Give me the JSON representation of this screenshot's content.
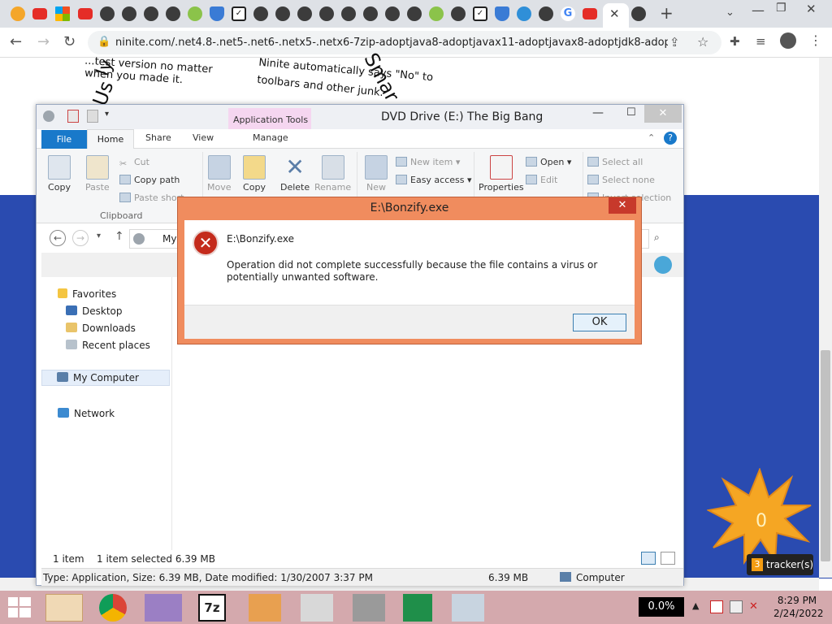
{
  "browser": {
    "url": "ninite.com/.net4.8-.net5-.net6-.netx5-.netx6-7zip-adoptjava8-adoptjavax11-adoptjavax8-adoptjdk8-adoptj...",
    "new_tab": "+"
  },
  "webpage": {
    "text1": "...test version no matter",
    "text2": "when you made it.",
    "text3": "Ninite automatically says \"No\" to",
    "text4": "toolbars and other junk.",
    "deco1": "Us",
    "deco2": "Smar",
    "deco3": "ly",
    "starburst_label": "0",
    "tracker_count": "3",
    "tracker_label": "tracker(s)"
  },
  "explorer": {
    "title": "DVD Drive (E:) The Big Bang",
    "context_tab": "Application Tools",
    "tabs": {
      "file": "File",
      "home": "Home",
      "share": "Share",
      "view": "View",
      "manage": "Manage"
    },
    "ribbon": {
      "copy": "Copy",
      "paste": "Paste",
      "cut": "Cut",
      "copy_path": "Copy path",
      "paste_shortcut": "Paste short",
      "clipboard_group": "Clipboard",
      "move": "Move",
      "copy_to": "Copy",
      "delete": "Delete",
      "rename": "Rename",
      "new": "New",
      "new_item": "New item",
      "easy_access": "Easy access",
      "properties": "Properties",
      "open": "Open",
      "edit": "Edit",
      "select_all": "Select all",
      "select_none": "Select none",
      "invert_selection": "Invert selection"
    },
    "path": "My",
    "nav": {
      "favorites": "Favorites",
      "desktop": "Desktop",
      "downloads": "Downloads",
      "recent": "Recent places",
      "my_computer": "My Computer",
      "network": "Network"
    },
    "status": {
      "items": "1 item",
      "selected": "1 item selected  6.39 MB"
    },
    "details": {
      "info": "Type: Application, Size: 6.39 MB, Date modified: 1/30/2007 3:37 PM",
      "size": "6.39 MB",
      "location": "Computer"
    }
  },
  "dialog": {
    "title": "E:\\Bonzify.exe",
    "heading": "E:\\Bonzify.exe",
    "message": "Operation did not complete successfully because the file contains a virus or potentially unwanted software.",
    "ok": "OK",
    "close": "✕"
  },
  "taskbar": {
    "cpu": "0.0%",
    "time": "8:29 PM",
    "date": "2/24/2022",
    "7z": "7z"
  }
}
